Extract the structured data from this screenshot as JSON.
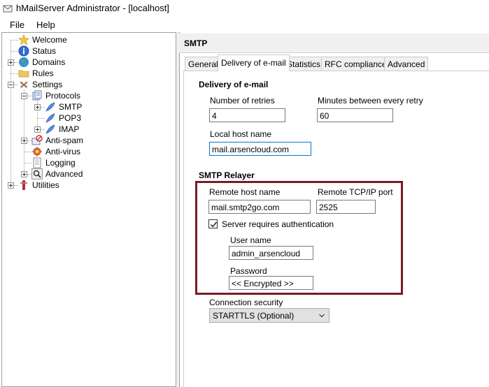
{
  "window": {
    "title": "hMailServer Administrator - [localhost]"
  },
  "menu": {
    "file": "File",
    "help": "Help"
  },
  "tree": {
    "welcome": "Welcome",
    "status": "Status",
    "domains": "Domains",
    "rules": "Rules",
    "settings": "Settings",
    "protocols": "Protocols",
    "smtp": "SMTP",
    "pop3": "POP3",
    "imap": "IMAP",
    "antispam": "Anti-spam",
    "antivirus": "Anti-virus",
    "logging": "Logging",
    "advanced": "Advanced",
    "utilities": "Utilities"
  },
  "panel": {
    "header": "SMTP",
    "tabs": [
      "General",
      "Delivery of e-mail",
      "Statistics",
      "RFC compliance",
      "Advanced"
    ],
    "active_tab": "Delivery of e-mail"
  },
  "delivery": {
    "title": "Delivery of e-mail",
    "retries_label": "Number of retries",
    "retries_value": "4",
    "minutes_label": "Minutes between every retry",
    "minutes_value": "60",
    "localhost_label": "Local host name",
    "localhost_value": "mail.arsencloud.com"
  },
  "relayer": {
    "title": "SMTP Relayer",
    "remote_host_label": "Remote host name",
    "remote_host_value": "mail.smtp2go.com",
    "port_label": "Remote TCP/IP port",
    "port_value": "2525",
    "auth_label": "Server requires authentication",
    "auth_checked": true,
    "username_label": "User name",
    "username_value": "admin_arsencloud",
    "password_label": "Password",
    "password_value": "<< Encrypted >>",
    "security_label": "Connection security",
    "security_value": "STARTTLS (Optional)"
  },
  "colors": {
    "highlight_box": "#7a1a24",
    "focus_border": "#0078d7"
  }
}
